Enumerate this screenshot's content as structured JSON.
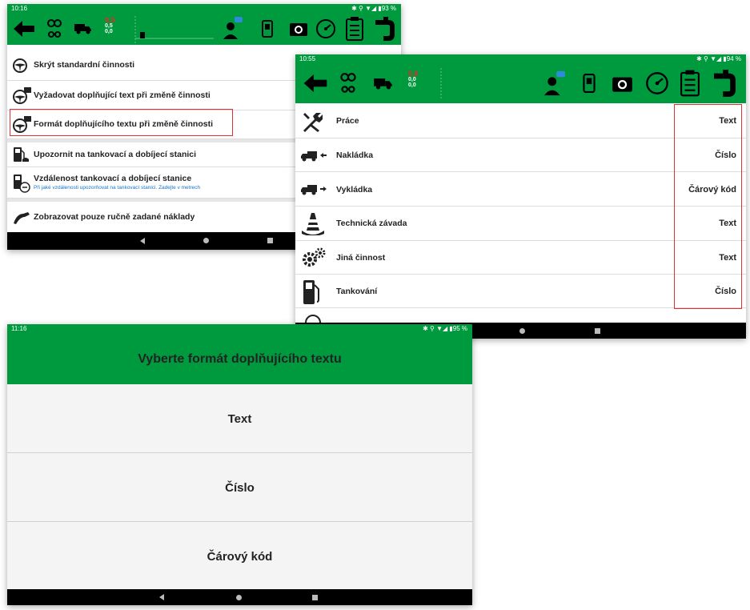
{
  "shot1": {
    "status_time": "10:16",
    "status_right": "✱ ⚲ ▼◢ ▮93 %",
    "readout": [
      "0,5",
      "0,5",
      "0,0"
    ],
    "items": [
      {
        "label": "Skrýt standardní činnosti",
        "icon": "steering-wheel-icon"
      },
      {
        "label": "Vyžadovat doplňující text při změně činnosti",
        "icon": "steering-wheel-message-icon"
      },
      {
        "label": "Formát doplňujícího textu při změně činnosti",
        "icon": "steering-wheel-message-icon"
      },
      {
        "label": "Upozornit na tankovací a dobíjecí stanici",
        "icon": "fuel-pump-bell-icon"
      },
      {
        "label": "Vzdálenost tankovací a dobíjecí stanice",
        "sub": "Při jaké vzdálenosti upozorňovat na tankovací stanici. Zadejte v metrech",
        "icon": "fuel-pump-distance-icon"
      },
      {
        "label": "Zobrazovat pouze ručně zadané náklady",
        "icon": "fuel-nozzle-icon"
      }
    ]
  },
  "shot2": {
    "status_time": "10:55",
    "status_right": "✱ ⚲ ▼◢ ▮94 %",
    "readout": [
      "0,0",
      "0,0",
      "0,0"
    ],
    "items": [
      {
        "label": "Práce",
        "value": "Text",
        "icon": "tools-icon"
      },
      {
        "label": "Nakládka",
        "value": "Číslo",
        "icon": "truck-loading-icon"
      },
      {
        "label": "Vykládka",
        "value": "Čárový kód",
        "icon": "truck-unloading-icon"
      },
      {
        "label": "Technická závada",
        "value": "Text",
        "icon": "traffic-cone-icon"
      },
      {
        "label": "Jiná činnost",
        "value": "Text",
        "icon": "gears-icon"
      },
      {
        "label": "Tankování",
        "value": "Číslo",
        "icon": "fuel-pump-icon"
      }
    ]
  },
  "shot3": {
    "status_time": "11:16",
    "status_right": "✱ ⚲ ▼◢ ▮95 %",
    "title": "Vyberte formát doplňujícího textu",
    "options": [
      "Text",
      "Číslo",
      "Čárový kód"
    ]
  },
  "colors": {
    "brand_green": "#009a3e",
    "highlight_red": "#e03030"
  }
}
